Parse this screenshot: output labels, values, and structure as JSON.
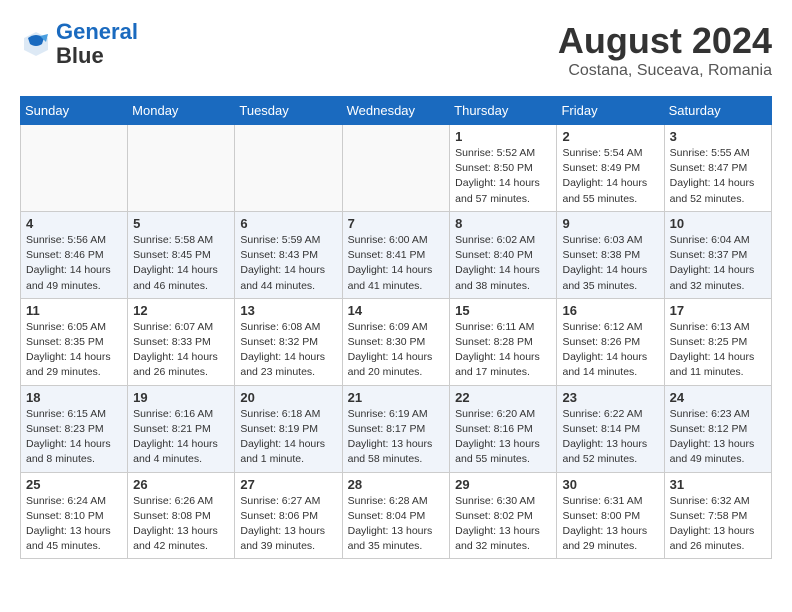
{
  "header": {
    "logo_line1": "General",
    "logo_line2": "Blue",
    "month": "August 2024",
    "location": "Costana, Suceava, Romania"
  },
  "weekdays": [
    "Sunday",
    "Monday",
    "Tuesday",
    "Wednesday",
    "Thursday",
    "Friday",
    "Saturday"
  ],
  "weeks": [
    [
      {
        "day": "",
        "content": ""
      },
      {
        "day": "",
        "content": ""
      },
      {
        "day": "",
        "content": ""
      },
      {
        "day": "",
        "content": ""
      },
      {
        "day": "1",
        "content": "Sunrise: 5:52 AM\nSunset: 8:50 PM\nDaylight: 14 hours and 57 minutes."
      },
      {
        "day": "2",
        "content": "Sunrise: 5:54 AM\nSunset: 8:49 PM\nDaylight: 14 hours and 55 minutes."
      },
      {
        "day": "3",
        "content": "Sunrise: 5:55 AM\nSunset: 8:47 PM\nDaylight: 14 hours and 52 minutes."
      }
    ],
    [
      {
        "day": "4",
        "content": "Sunrise: 5:56 AM\nSunset: 8:46 PM\nDaylight: 14 hours and 49 minutes."
      },
      {
        "day": "5",
        "content": "Sunrise: 5:58 AM\nSunset: 8:45 PM\nDaylight: 14 hours and 46 minutes."
      },
      {
        "day": "6",
        "content": "Sunrise: 5:59 AM\nSunset: 8:43 PM\nDaylight: 14 hours and 44 minutes."
      },
      {
        "day": "7",
        "content": "Sunrise: 6:00 AM\nSunset: 8:41 PM\nDaylight: 14 hours and 41 minutes."
      },
      {
        "day": "8",
        "content": "Sunrise: 6:02 AM\nSunset: 8:40 PM\nDaylight: 14 hours and 38 minutes."
      },
      {
        "day": "9",
        "content": "Sunrise: 6:03 AM\nSunset: 8:38 PM\nDaylight: 14 hours and 35 minutes."
      },
      {
        "day": "10",
        "content": "Sunrise: 6:04 AM\nSunset: 8:37 PM\nDaylight: 14 hours and 32 minutes."
      }
    ],
    [
      {
        "day": "11",
        "content": "Sunrise: 6:05 AM\nSunset: 8:35 PM\nDaylight: 14 hours and 29 minutes."
      },
      {
        "day": "12",
        "content": "Sunrise: 6:07 AM\nSunset: 8:33 PM\nDaylight: 14 hours and 26 minutes."
      },
      {
        "day": "13",
        "content": "Sunrise: 6:08 AM\nSunset: 8:32 PM\nDaylight: 14 hours and 23 minutes."
      },
      {
        "day": "14",
        "content": "Sunrise: 6:09 AM\nSunset: 8:30 PM\nDaylight: 14 hours and 20 minutes."
      },
      {
        "day": "15",
        "content": "Sunrise: 6:11 AM\nSunset: 8:28 PM\nDaylight: 14 hours and 17 minutes."
      },
      {
        "day": "16",
        "content": "Sunrise: 6:12 AM\nSunset: 8:26 PM\nDaylight: 14 hours and 14 minutes."
      },
      {
        "day": "17",
        "content": "Sunrise: 6:13 AM\nSunset: 8:25 PM\nDaylight: 14 hours and 11 minutes."
      }
    ],
    [
      {
        "day": "18",
        "content": "Sunrise: 6:15 AM\nSunset: 8:23 PM\nDaylight: 14 hours and 8 minutes."
      },
      {
        "day": "19",
        "content": "Sunrise: 6:16 AM\nSunset: 8:21 PM\nDaylight: 14 hours and 4 minutes."
      },
      {
        "day": "20",
        "content": "Sunrise: 6:18 AM\nSunset: 8:19 PM\nDaylight: 14 hours and 1 minute."
      },
      {
        "day": "21",
        "content": "Sunrise: 6:19 AM\nSunset: 8:17 PM\nDaylight: 13 hours and 58 minutes."
      },
      {
        "day": "22",
        "content": "Sunrise: 6:20 AM\nSunset: 8:16 PM\nDaylight: 13 hours and 55 minutes."
      },
      {
        "day": "23",
        "content": "Sunrise: 6:22 AM\nSunset: 8:14 PM\nDaylight: 13 hours and 52 minutes."
      },
      {
        "day": "24",
        "content": "Sunrise: 6:23 AM\nSunset: 8:12 PM\nDaylight: 13 hours and 49 minutes."
      }
    ],
    [
      {
        "day": "25",
        "content": "Sunrise: 6:24 AM\nSunset: 8:10 PM\nDaylight: 13 hours and 45 minutes."
      },
      {
        "day": "26",
        "content": "Sunrise: 6:26 AM\nSunset: 8:08 PM\nDaylight: 13 hours and 42 minutes."
      },
      {
        "day": "27",
        "content": "Sunrise: 6:27 AM\nSunset: 8:06 PM\nDaylight: 13 hours and 39 minutes."
      },
      {
        "day": "28",
        "content": "Sunrise: 6:28 AM\nSunset: 8:04 PM\nDaylight: 13 hours and 35 minutes."
      },
      {
        "day": "29",
        "content": "Sunrise: 6:30 AM\nSunset: 8:02 PM\nDaylight: 13 hours and 32 minutes."
      },
      {
        "day": "30",
        "content": "Sunrise: 6:31 AM\nSunset: 8:00 PM\nDaylight: 13 hours and 29 minutes."
      },
      {
        "day": "31",
        "content": "Sunrise: 6:32 AM\nSunset: 7:58 PM\nDaylight: 13 hours and 26 minutes."
      }
    ]
  ]
}
